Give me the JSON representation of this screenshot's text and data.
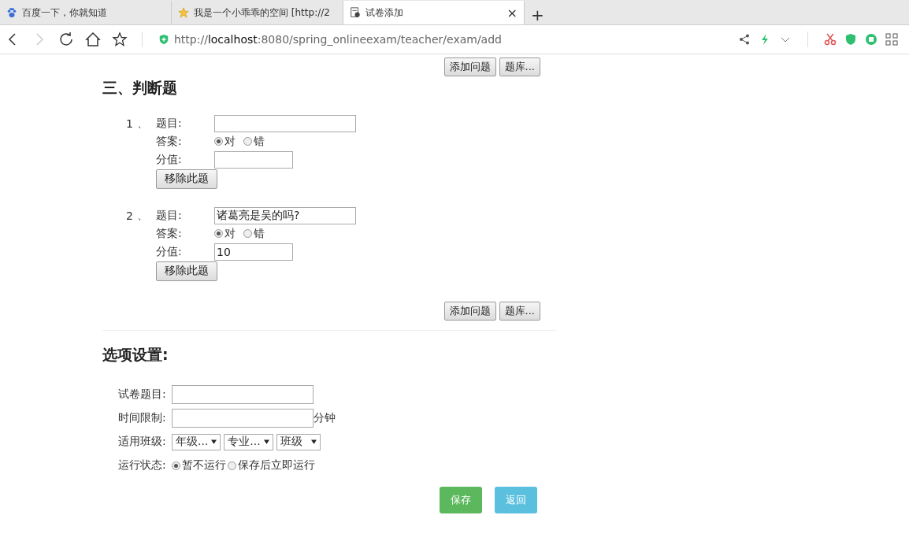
{
  "browser": {
    "tabs": [
      {
        "title": "百度一下，你就知道",
        "kind": "paw",
        "selected": false
      },
      {
        "title": "我是一个小乖乖的空间 [http://2",
        "kind": "star",
        "selected": false
      },
      {
        "title": "试卷添加",
        "kind": "doc",
        "selected": true,
        "close": "×"
      }
    ],
    "new_tab": "+",
    "url": {
      "scheme": "http://",
      "host": "localhost",
      "path": ":8080/spring_onlineexam/teacher/exam/add"
    }
  },
  "page": {
    "top_buttons": [
      "添加问题",
      "题库..."
    ],
    "section_title": "三、判断题",
    "questions": [
      {
        "number": "1",
        "separator": "、",
        "question_label": "题目:",
        "answer_label": "答案:",
        "options": [
          {
            "label": "对",
            "selected": true
          },
          {
            "label": "错",
            "selected": false
          }
        ],
        "score_label": "分值:",
        "remove_button": "移除此题"
      },
      {
        "number": "2",
        "separator": "、",
        "question_label": "题目:",
        "question_value": "诸葛亮是吴的吗?",
        "answer_label": "答案:",
        "options": [
          {
            "label": "对",
            "selected": true
          },
          {
            "label": "错",
            "selected": false
          }
        ],
        "score_label": "分值:",
        "score_value": "10",
        "remove_button": "移除此题"
      }
    ],
    "bottom_buttons": [
      "添加问题",
      "题库..."
    ],
    "settings_title": "选项设置:",
    "exam_title": {
      "label": "试卷题目:"
    },
    "time_limit": {
      "label": "时间限制:",
      "unit": "分钟"
    },
    "classes": {
      "label": "适用班级:",
      "selects": [
        "年级...",
        "专业...",
        "班级"
      ]
    },
    "run_state": {
      "label": "运行状态:",
      "options": [
        {
          "label": "暂不运行",
          "selected": true
        },
        {
          "label": "保存后立即运行",
          "selected": false
        }
      ]
    },
    "save_button": "保存",
    "back_button": "返回"
  }
}
